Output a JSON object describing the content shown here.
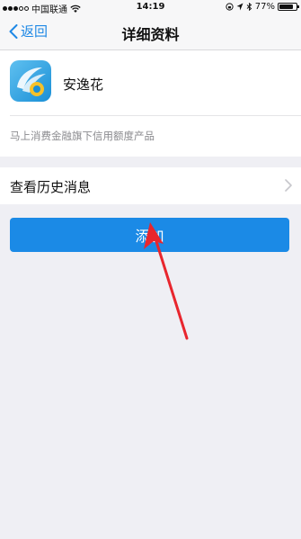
{
  "status_bar": {
    "carrier": "中国联通",
    "time": "14:19",
    "battery": "77%",
    "battery_level": 0.77,
    "signal_bars_filled": 3,
    "signal_bars_total": 5
  },
  "nav": {
    "back_label": "返回",
    "title": "详细资料"
  },
  "profile": {
    "name": "安逸花",
    "description": "马上消费金融旗下信用额度产品",
    "icon": "app-logo-icon"
  },
  "history": {
    "label": "查看历史消息"
  },
  "actions": {
    "add_label": "添加"
  },
  "colors": {
    "accent": "#1b8ae6",
    "background": "#efeff4",
    "annotation_arrow": "#e8262e"
  }
}
